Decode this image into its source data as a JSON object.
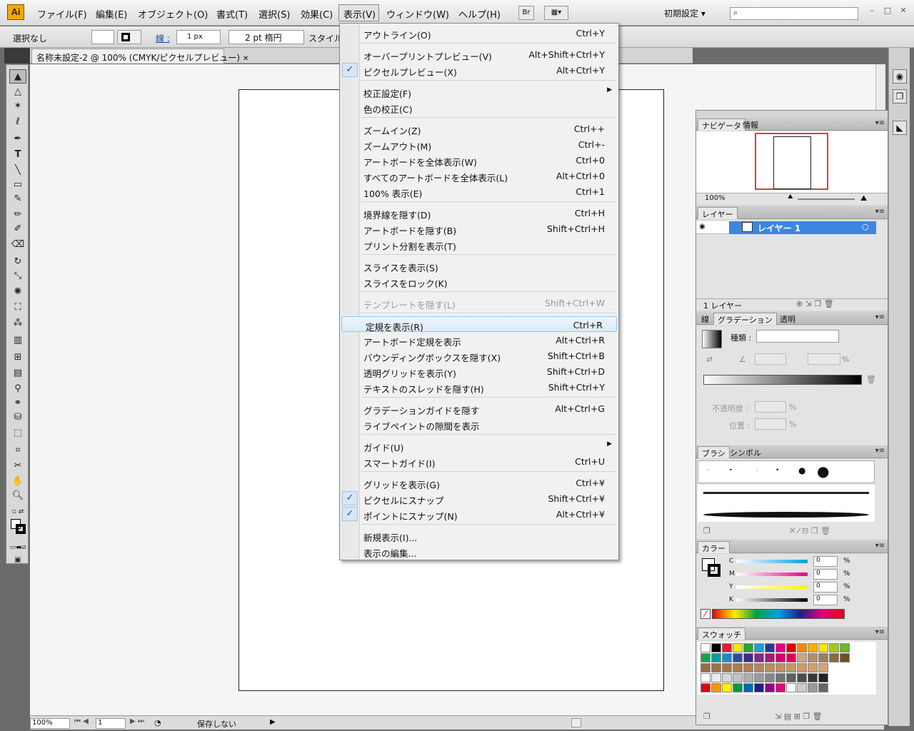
{
  "app": {
    "logo": "Ai"
  },
  "menubar": {
    "items": [
      "ファイル(F)",
      "編集(E)",
      "オブジェクト(O)",
      "書式(T)",
      "選択(S)",
      "効果(C)",
      "表示(V)",
      "ウィンドウ(W)",
      "ヘルプ(H)"
    ],
    "bridge_label": "Br",
    "workspace": "初期設定",
    "window_buttons": [
      "–",
      "□",
      "✕"
    ]
  },
  "controlbar": {
    "selection": "選択なし",
    "stroke_label": "線 :",
    "stroke_width": "1 px",
    "brush": "2 pt 楕円",
    "style_label": "スタイル"
  },
  "document": {
    "tab_title": "名称未設定-2 @ 100% (CMYK/ピクセルプレビュー)",
    "zoom": "100%",
    "artboard_index": "1",
    "save_status": "保存しない"
  },
  "view_menu": {
    "items": [
      {
        "label": "アウトライン(O)",
        "shortcut": "Ctrl+Y"
      },
      {
        "label": "オーバープリントプレビュー(V)",
        "shortcut": "Alt+Shift+Ctrl+Y"
      },
      {
        "label": "ピクセルプレビュー(X)",
        "shortcut": "Alt+Ctrl+Y",
        "checked": true
      },
      {
        "label": "校正設定(F)",
        "shortcut": "",
        "submenu": true
      },
      {
        "label": "色の校正(C)",
        "shortcut": ""
      },
      {
        "label": "ズームイン(Z)",
        "shortcut": "Ctrl++"
      },
      {
        "label": "ズームアウト(M)",
        "shortcut": "Ctrl+-"
      },
      {
        "label": "アートボードを全体表示(W)",
        "shortcut": "Ctrl+0"
      },
      {
        "label": "すべてのアートボードを全体表示(L)",
        "shortcut": "Alt+Ctrl+0"
      },
      {
        "label": "100% 表示(E)",
        "shortcut": "Ctrl+1"
      },
      {
        "label": "境界線を隠す(D)",
        "shortcut": "Ctrl+H"
      },
      {
        "label": "アートボードを隠す(B)",
        "shortcut": "Shift+Ctrl+H"
      },
      {
        "label": "プリント分割を表示(T)",
        "shortcut": ""
      },
      {
        "label": "スライスを表示(S)",
        "shortcut": ""
      },
      {
        "label": "スライスをロック(K)",
        "shortcut": ""
      },
      {
        "label": "テンプレートを隠す(L)",
        "shortcut": "Shift+Ctrl+W",
        "disabled": true
      },
      {
        "label": "定規を表示(R)",
        "shortcut": "Ctrl+R",
        "highlighted": true
      },
      {
        "label": "アートボード定規を表示",
        "shortcut": "Alt+Ctrl+R"
      },
      {
        "label": "バウンディングボックスを隠す(X)",
        "shortcut": "Shift+Ctrl+B"
      },
      {
        "label": "透明グリッドを表示(Y)",
        "shortcut": "Shift+Ctrl+D"
      },
      {
        "label": "テキストのスレッドを隠す(H)",
        "shortcut": "Shift+Ctrl+Y"
      },
      {
        "label": "グラデーションガイドを隠す",
        "shortcut": "Alt+Ctrl+G"
      },
      {
        "label": "ライブペイントの隙間を表示",
        "shortcut": ""
      },
      {
        "label": "ガイド(U)",
        "shortcut": "",
        "submenu": true
      },
      {
        "label": "スマートガイド(I)",
        "shortcut": "Ctrl+U"
      },
      {
        "label": "グリッドを表示(G)",
        "shortcut": "Ctrl+¥"
      },
      {
        "label": "ピクセルにスナップ",
        "shortcut": "Shift+Ctrl+¥",
        "checked": true
      },
      {
        "label": "ポイントにスナップ(N)",
        "shortcut": "Alt+Ctrl+¥",
        "checked": true
      },
      {
        "label": "新規表示(I)...",
        "shortcut": ""
      },
      {
        "label": "表示の編集...",
        "shortcut": ""
      }
    ]
  },
  "panels": {
    "navigator": {
      "tabs": [
        "ナビゲータ",
        "情報"
      ],
      "zoom": "100%"
    },
    "layers": {
      "tab": "レイヤー",
      "layer_name": "レイヤー 1",
      "count": "1 レイヤー"
    },
    "gradient": {
      "tabs": [
        "線",
        "グラデーション",
        "透明"
      ],
      "type_label": "種類 :",
      "opacity_label": "不透明度 :",
      "position_label": "位置 :",
      "percent": "%"
    },
    "brushes": {
      "tabs": [
        "ブラシ",
        "シンボル"
      ]
    },
    "color": {
      "tab": "カラー",
      "channels": [
        {
          "name": "C",
          "value": "0"
        },
        {
          "name": "M",
          "value": "0"
        },
        {
          "name": "Y",
          "value": "0"
        },
        {
          "name": "K",
          "value": "0"
        }
      ],
      "percent": "%"
    },
    "swatches": {
      "tab": "スウォッチ"
    }
  },
  "colors": {
    "accent_selected_layer": "#3d86e0",
    "swatch_row1": [
      "#ffffff",
      "#000000",
      "#e0202a",
      "#f6e500",
      "#2aa538",
      "#1aa0e0",
      "#2b3893",
      "#e5007f",
      "#e00000",
      "#f08c00",
      "#f5b300",
      "#f6e500",
      "#a6c81e",
      "#6cb82c"
    ],
    "swatch_row2": [
      "#1e9f4f",
      "#00a0a0",
      "#1c8ac9",
      "#2c4ba0",
      "#3d2a8a",
      "#7d2a8a",
      "#a01e6e",
      "#d4006e",
      "#e30054",
      "#c8a880",
      "#b09070",
      "#988060",
      "#8a6a40",
      "#704e2a"
    ]
  }
}
